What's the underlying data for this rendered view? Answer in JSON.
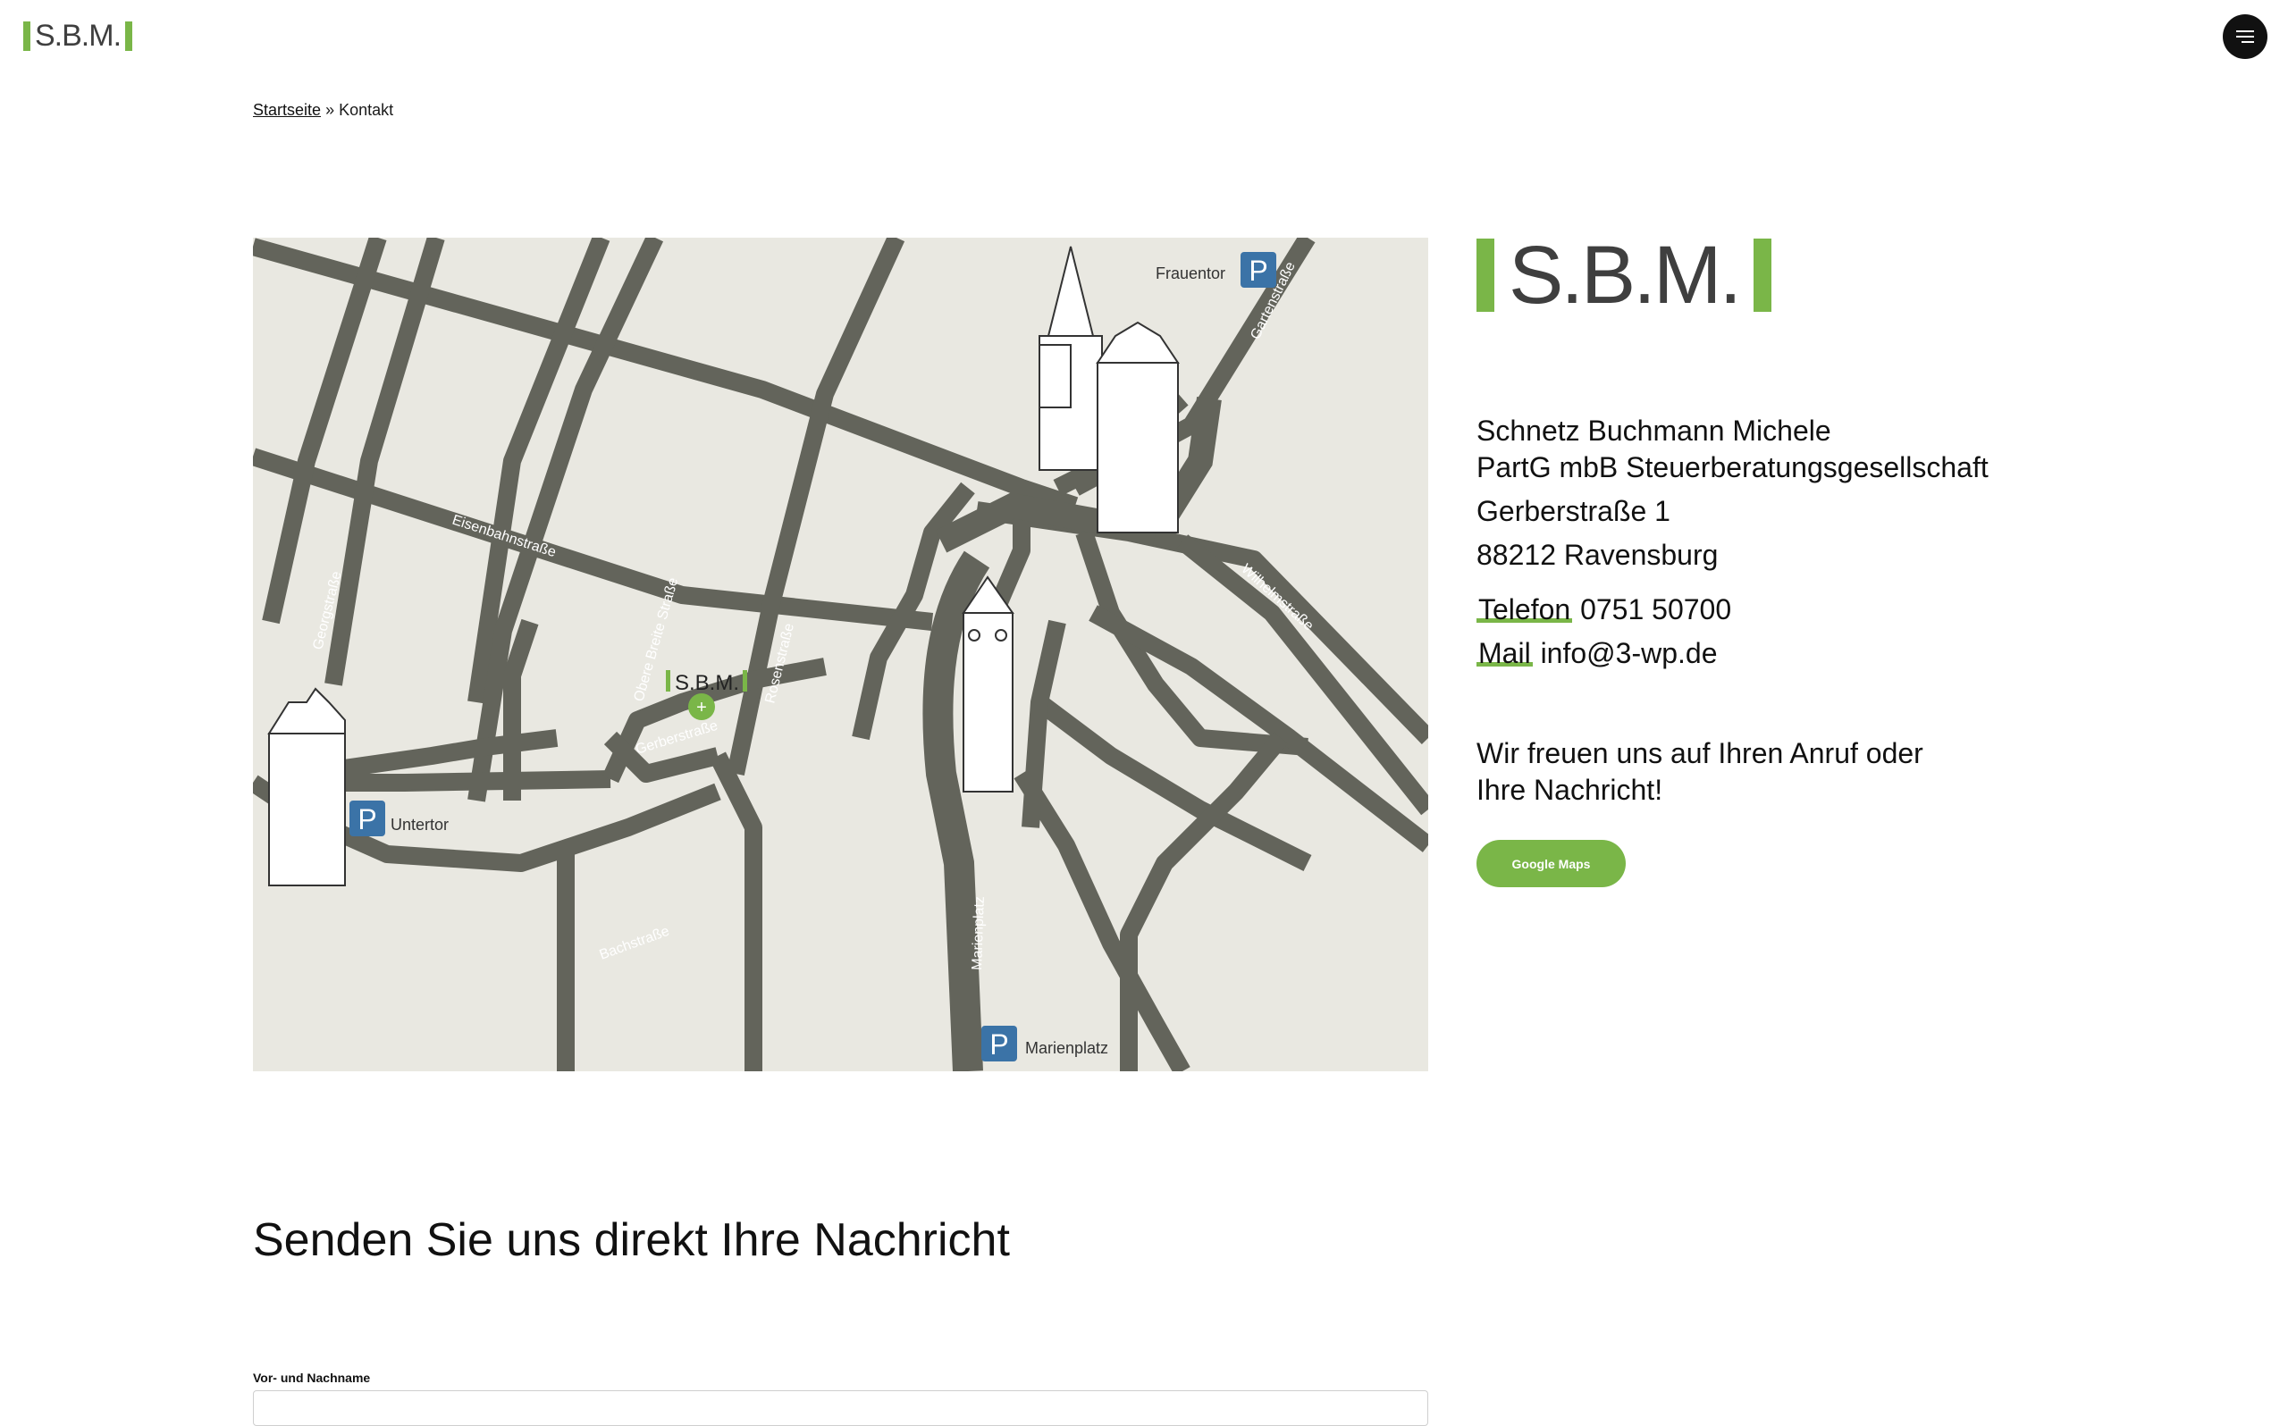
{
  "header": {
    "logo_text": "S.B.M.",
    "menu_icon": "hamburger-icon"
  },
  "breadcrumb": {
    "home": "Startseite",
    "separator": "»",
    "current": "Kontakt"
  },
  "map": {
    "streets": {
      "eisenbahn": "Eisenbahnstraße",
      "georg": "Georgstraße",
      "obere_breite": "Obere Breite Straße",
      "rosen": "Rosenstraße",
      "gerber": "Gerberstraße",
      "bach": "Bachstraße",
      "marienplatz_street": "Marienplatz",
      "garten": "Gartenstraße",
      "wilhelm": "Wilhelmstraße"
    },
    "parking": {
      "frauentor": "Frauentor",
      "untertor": "Untertor",
      "marienplatz": "Marienplatz"
    },
    "parking_symbol": "P",
    "marker_logo": "S.B.M.",
    "marker_plus": "+"
  },
  "company": {
    "logo_text": "S.B.M.",
    "name_line1": "Schnetz Buchmann Michele",
    "name_line2": "PartG mbB Steuerberatungsgesellschaft",
    "street": "Gerberstraße 1",
    "city": "88212 Ravensburg",
    "phone_label": "Telefon",
    "phone": "0751 50700",
    "mail_label": "Mail",
    "mail": "info@3-wp.de",
    "cta_line1": "Wir freuen uns auf Ihren Anruf oder",
    "cta_line2": "Ihre Nachricht!",
    "maps_button": "Google Maps"
  },
  "form": {
    "heading": "Senden Sie uns direkt Ihre Nachricht",
    "name_label": "Vor- und Nachname",
    "name_value": ""
  },
  "colors": {
    "accent_green": "#7ab648",
    "map_bg": "#e9e8e1",
    "road": "#63645b",
    "parking_blue": "#3b73a7"
  }
}
